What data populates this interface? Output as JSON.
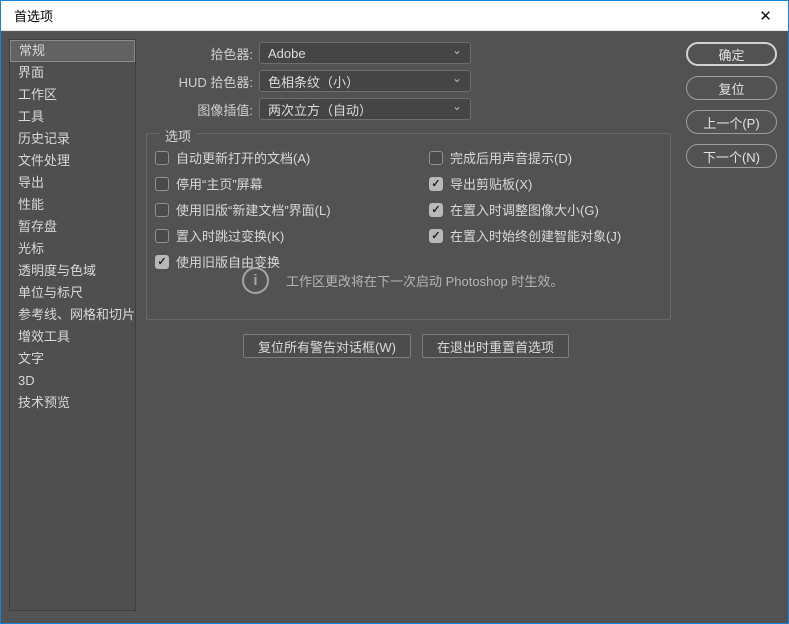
{
  "window": {
    "title": "首选项",
    "close_icon": "✕"
  },
  "sidebar": {
    "selected_index": 0,
    "items": [
      "常规",
      "界面",
      "工作区",
      "工具",
      "历史记录",
      "文件处理",
      "导出",
      "性能",
      "暂存盘",
      "光标",
      "透明度与色域",
      "单位与标尺",
      "参考线、网格和切片",
      "增效工具",
      "文字",
      "3D",
      "技术预览"
    ]
  },
  "form": {
    "chevron_icon": "⌄",
    "rows": [
      {
        "label": "拾色器:",
        "value": "Adobe"
      },
      {
        "label": "HUD 拾色器:",
        "value": "色相条纹（小）"
      },
      {
        "label": "图像插值:",
        "value": "两次立方（自动）"
      }
    ]
  },
  "options": {
    "legend": "选项",
    "check_icon": "✓",
    "left": [
      {
        "label": "自动更新打开的文档(A)",
        "checked": false
      },
      {
        "label": "停用“主页”屏幕",
        "checked": false
      },
      {
        "label": "使用旧版“新建文档”界面(L)",
        "checked": false
      },
      {
        "label": "置入时跳过变换(K)",
        "checked": false
      },
      {
        "label": "使用旧版自由变换",
        "checked": true
      }
    ],
    "right": [
      {
        "label": "完成后用声音提示(D)",
        "checked": false
      },
      {
        "label": "导出剪贴板(X)",
        "checked": true
      },
      {
        "label": "在置入时调整图像大小(G)",
        "checked": true
      },
      {
        "label": "在置入时始终创建智能对象(J)",
        "checked": true
      }
    ],
    "info_icon": "i",
    "info_text": "工作区更改将在下一次启动 Photoshop 时生效。"
  },
  "footer_buttons": [
    {
      "label": "复位所有警告对话框(W)"
    },
    {
      "label": "在退出时重置首选项"
    }
  ],
  "action_buttons": [
    {
      "label": "确定",
      "default": true
    },
    {
      "label": "复位",
      "default": false
    },
    {
      "label": "上一个(P)",
      "default": false
    },
    {
      "label": "下一个(N)",
      "default": false
    }
  ],
  "colors": {
    "window_border": "#1883d7",
    "titlebar_bg": "#ffffff",
    "dialog_bg": "#525252",
    "control_bg": "#454545",
    "control_border": "#6e6e6e",
    "text": "#dcdcdc",
    "checkbox_checked_fill": "#b8b8b8"
  }
}
